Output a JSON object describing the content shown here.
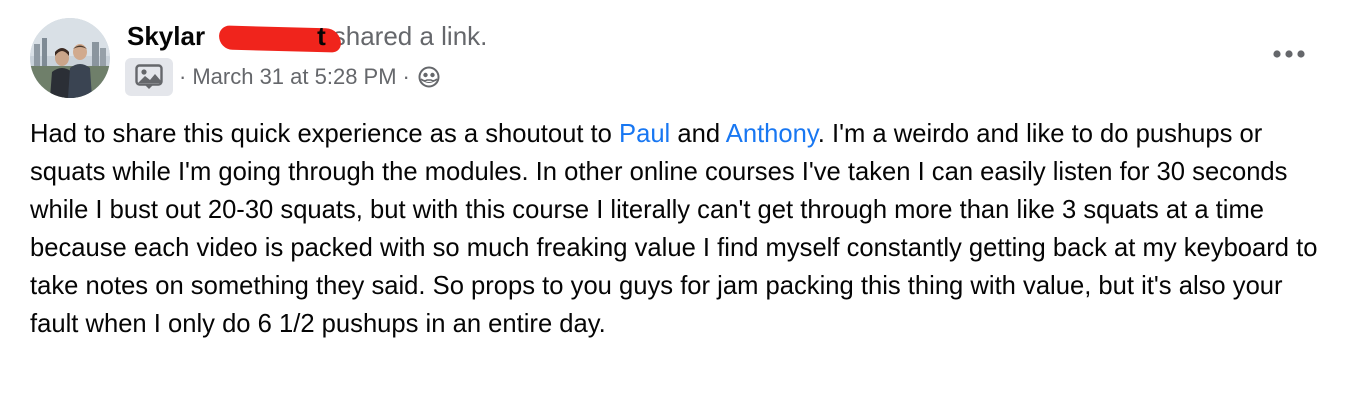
{
  "author": {
    "name_visible_start": "Skylar",
    "name_visible_end": "t"
  },
  "header": {
    "action_text": "shared a link."
  },
  "meta": {
    "separator": "·",
    "timestamp": "March 31 at 5:28 PM"
  },
  "icons": {
    "group": "photo-group-icon",
    "audience": "globe-icon",
    "more": "more-horizontal-icon"
  },
  "colors": {
    "mention": "#1877f2",
    "secondary_text": "#65676b",
    "redaction": "#f0241c"
  },
  "post": {
    "text_before_paul": "Had to share this quick experience as a shoutout to ",
    "mention_1": "Paul",
    "text_between": " and ",
    "mention_2": "Anthony",
    "text_after": ". I'm a weirdo and like to do pushups or squats while I'm going through the modules. In other online courses I've taken I can easily listen for 30 seconds while I bust out 20-30 squats, but with this course I literally can't get through more than like 3 squats at a time because each video is packed with so much freaking value I find myself constantly getting back at my keyboard to take notes on something they said. So props to you guys for jam packing this thing with value, but it's also your fault when I only do 6 1/2 pushups in an entire day."
  }
}
